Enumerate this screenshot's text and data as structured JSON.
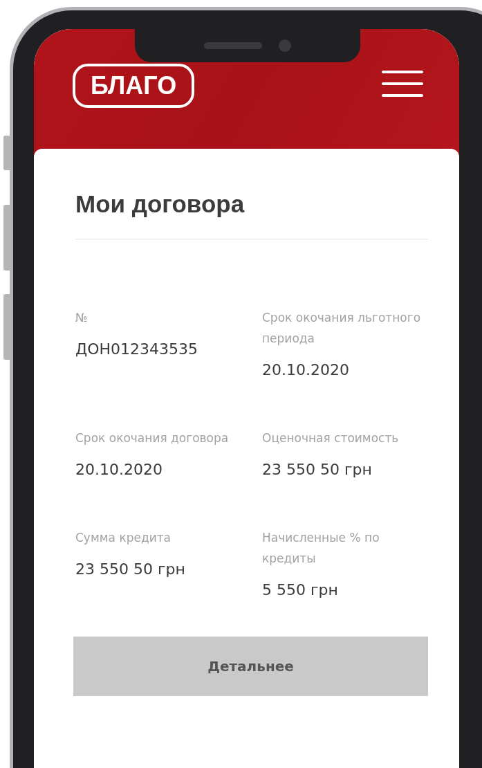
{
  "header": {
    "logo": "БЛАГО"
  },
  "page_title": "Мои договора",
  "fields": [
    {
      "label": "№",
      "value": "ДОН012343535"
    },
    {
      "label": "Срок окочания льготного периода",
      "value": "20.10.2020"
    },
    {
      "label": "Срок окочания договора",
      "value": "20.10.2020"
    },
    {
      "label": "Оценочная стоимость",
      "value": "23 550 50 грн"
    },
    {
      "label": "Сумма кредита",
      "value": "23 550 50 грн"
    },
    {
      "label": "Начисленные % по кредиты",
      "value": "5 550 грн"
    }
  ],
  "button": "Детальнее"
}
